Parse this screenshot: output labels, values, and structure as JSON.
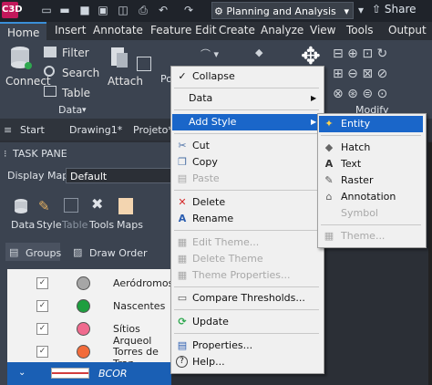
{
  "titlebar": {
    "logo_text": "C3D",
    "workspace": "Planning and Analysis",
    "share": "Share"
  },
  "ribbon_tabs": [
    "Home",
    "Insert",
    "Annotate",
    "Feature Edit",
    "Create",
    "Analyze",
    "View",
    "Tools",
    "Output"
  ],
  "ribbon": {
    "connect": "Connect",
    "filter": "Filter",
    "search": "Search",
    "table": "Table",
    "attach": "Attach",
    "data_panel": "Data",
    "modify_panel": "Modify"
  },
  "doc_tabs": [
    "Start",
    "Drawing1*",
    "Projeto*"
  ],
  "taskpane": {
    "title": "TASK PANE",
    "display_map_label": "Display Map:",
    "display_map_value": "Default",
    "tools": [
      "Data",
      "Style",
      "Table",
      "Tools",
      "Maps"
    ],
    "groups": "Groups",
    "draw_order": "Draw Order",
    "layers": [
      {
        "name": "Aeródromos",
        "color": "#a6a6a6"
      },
      {
        "name": "Nascentes",
        "color": "#1e9e3f"
      },
      {
        "name": "Sítios Arqueol",
        "color": "#f06a8e"
      },
      {
        "name": "Torres de Tran",
        "color": "#f26b3a"
      }
    ],
    "selected_layer": "BCOR"
  },
  "context_menu": {
    "collapse": "Collapse",
    "data": "Data",
    "add_style": "Add Style",
    "cut": "Cut",
    "copy": "Copy",
    "paste": "Paste",
    "delete": "Delete",
    "rename": "Rename",
    "edit_theme": "Edit Theme...",
    "delete_theme": "Delete Theme",
    "theme_properties": "Theme Properties...",
    "compare_thresholds": "Compare Thresholds...",
    "update": "Update",
    "properties": "Properties...",
    "help": "Help..."
  },
  "submenu": {
    "entity": "Entity",
    "hatch": "Hatch",
    "text": "Text",
    "raster": "Raster",
    "annotation": "Annotation",
    "symbol": "Symbol",
    "theme": "Theme..."
  }
}
